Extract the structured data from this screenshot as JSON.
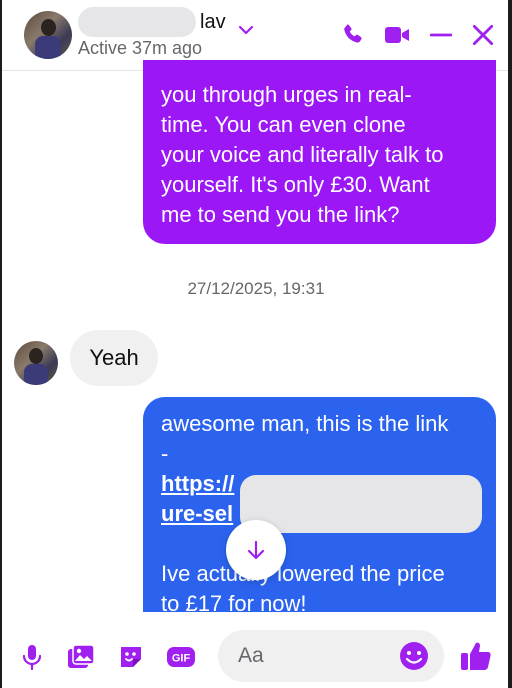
{
  "header": {
    "name_visible": "lav",
    "status": "Active 37m ago",
    "accent_color": "#a020f0"
  },
  "messages": {
    "purple_bubble": {
      "lines": [
        "you through urges in real-",
        "time. You can even clone",
        "your voice and literally talk to",
        "yourself. It's only £30. Want",
        "me to send you the link?"
      ]
    },
    "timestamp": "27/12/2025, 19:31",
    "incoming": {
      "text": "Yeah"
    },
    "blue_bubble": {
      "lines": [
        "awesome man, this is the link",
        "-",
        "https://",
        "ure-sel",
        "",
        "Ive actually lowered the price",
        "to £17 for now!"
      ]
    }
  },
  "composer": {
    "placeholder": "Aa",
    "gif_label": "GIF"
  },
  "icons": [
    "chevron-down-icon",
    "phone-icon",
    "video-camera-icon",
    "minimize-icon",
    "close-icon",
    "arrow-down-icon",
    "microphone-icon",
    "image-icon",
    "sticker-icon",
    "gif-icon",
    "emoji-icon",
    "thumbs-up-icon"
  ]
}
